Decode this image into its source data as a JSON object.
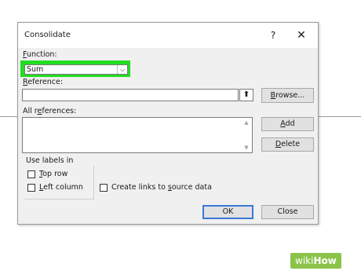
{
  "dialog": {
    "title": "Consolidate",
    "help_glyph": "?",
    "close_glyph": "✕"
  },
  "function": {
    "label_prefix": "F",
    "label_rest": "unction:",
    "value": "Sum",
    "dropdown_glyph": "⌵"
  },
  "reference": {
    "label_prefix": "R",
    "label_rest": "eference:",
    "value": "",
    "collapse_glyph": "⬆",
    "browse_prefix": "B",
    "browse_rest": "rowse..."
  },
  "all_references": {
    "label_before": "All r",
    "label_underlined": "e",
    "label_after": "ferences:",
    "scroll_up_glyph": "▲",
    "scroll_down_glyph": "▼"
  },
  "buttons": {
    "add_prefix": "A",
    "add_rest": "dd",
    "delete_prefix": "D",
    "delete_rest": "elete",
    "ok": "OK",
    "close": "Close"
  },
  "labels_group": {
    "title": "Use labels in",
    "top_row_prefix": "T",
    "top_row_rest": "op row",
    "left_column_prefix": "L",
    "left_column_rest": "eft column"
  },
  "links": {
    "before": "Create links to ",
    "underlined": "s",
    "after": "ource data"
  },
  "watermark": {
    "part1": "wiki",
    "part2": "How"
  },
  "colors": {
    "highlight": "#22dd22",
    "watermark_bg": "#8bc34a",
    "ok_border": "#3c78d8"
  }
}
